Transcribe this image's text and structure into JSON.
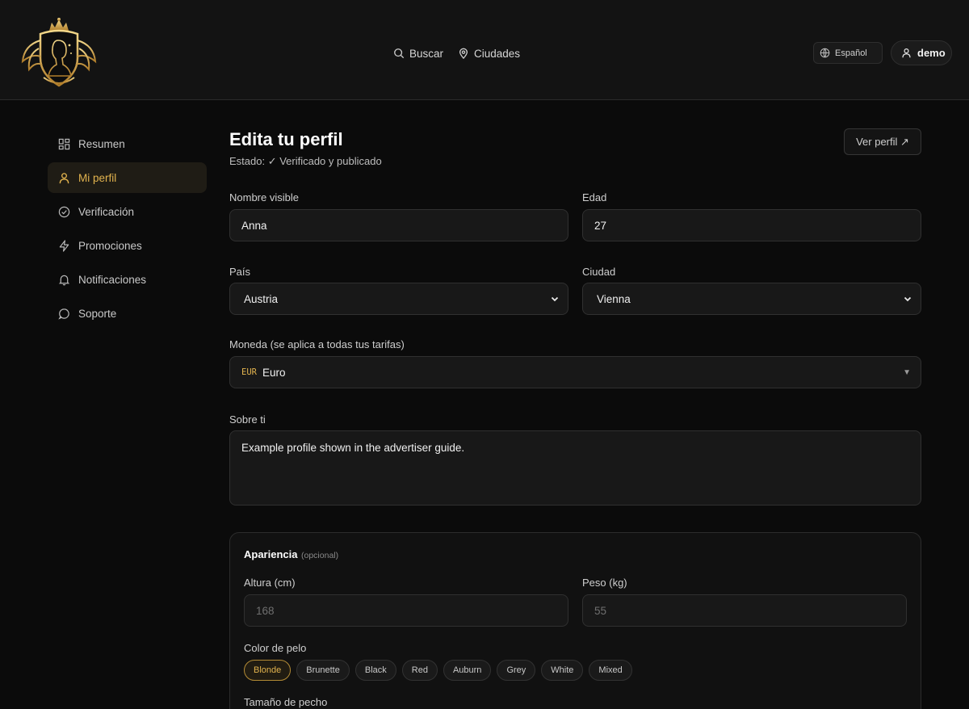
{
  "header": {
    "nav": [
      {
        "label": "Buscar",
        "icon": "search-icon"
      },
      {
        "label": "Ciudades",
        "icon": "map-pin-icon"
      }
    ],
    "language": "Español",
    "user": "demo"
  },
  "sidebar": {
    "items": [
      {
        "label": "Resumen",
        "icon": "grid-icon"
      },
      {
        "label": "Mi perfil",
        "icon": "user-icon",
        "active": true
      },
      {
        "label": "Verificación",
        "icon": "check-circle-icon"
      },
      {
        "label": "Promociones",
        "icon": "bolt-icon"
      },
      {
        "label": "Notificaciones",
        "icon": "bell-icon"
      },
      {
        "label": "Soporte",
        "icon": "chat-icon"
      }
    ]
  },
  "main": {
    "title": "Edita tu perfil",
    "status": "Estado: ✓ Verificado y publicado",
    "view_profile_label": "Ver perfil ↗",
    "fields": {
      "display_name": {
        "label": "Nombre visible",
        "value": "Anna"
      },
      "age": {
        "label": "Edad",
        "value": "27"
      },
      "country": {
        "label": "País",
        "value": "Austria"
      },
      "city": {
        "label": "Ciudad",
        "value": "Vienna"
      },
      "currency": {
        "label": "Moneda (se aplica a todas tus tarifas)",
        "code": "EUR",
        "value": "Euro"
      },
      "about": {
        "label": "Sobre ti",
        "value": "Example profile shown in the advertiser guide."
      }
    },
    "appearance": {
      "title": "Apariencia",
      "optional": "(opcional)",
      "height": {
        "label": "Altura (cm)",
        "placeholder": "168"
      },
      "weight": {
        "label": "Peso (kg)",
        "placeholder": "55"
      },
      "hair_color": {
        "label": "Color de pelo",
        "options": [
          "Blonde",
          "Brunette",
          "Black",
          "Red",
          "Auburn",
          "Grey",
          "White",
          "Mixed"
        ],
        "selected": "Blonde"
      },
      "breast_size": {
        "label": "Tamaño de pecho"
      }
    }
  },
  "colors": {
    "accent": "#e2b34e",
    "background": "#0b0b0b",
    "header": "#131313"
  }
}
